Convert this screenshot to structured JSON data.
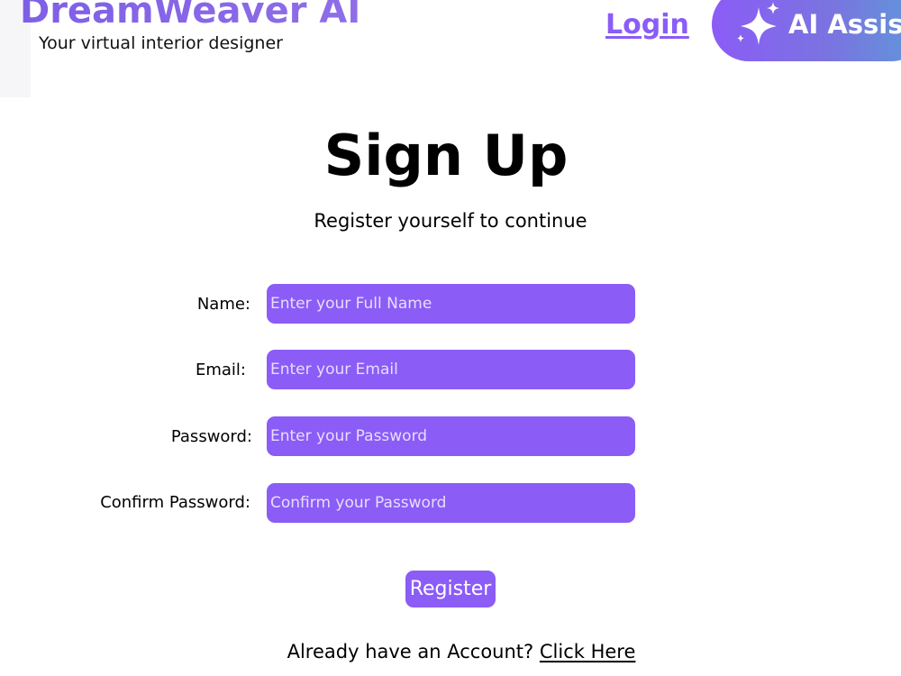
{
  "header": {
    "brand_title": "DreamWeaver AI",
    "brand_tagline": "Your virtual interior designer",
    "login_label": "Login",
    "ai_button_label": "AI Assist",
    "sparkle_icon": "sparkle-icon"
  },
  "main": {
    "title": "Sign Up",
    "subtitle": "Register yourself to continue"
  },
  "form": {
    "fields": [
      {
        "label": "Name:",
        "placeholder": "Enter your Full Name",
        "value": ""
      },
      {
        "label": "Email:",
        "placeholder": "Enter your Email",
        "value": ""
      },
      {
        "label": "Password:",
        "placeholder": "Enter your Password",
        "value": ""
      },
      {
        "label": "Confirm Password:",
        "placeholder": "Confirm your Password",
        "value": ""
      }
    ],
    "register_label": "Register"
  },
  "footer": {
    "account_prompt": "Already have an Account?",
    "account_link": "Click Here"
  },
  "colors": {
    "accent": "#8b5cf6",
    "brand_gradient_start": "#7e5fe6",
    "ai_gradient_end": "#5d9ad9",
    "placeholder": "#e8ddff"
  }
}
